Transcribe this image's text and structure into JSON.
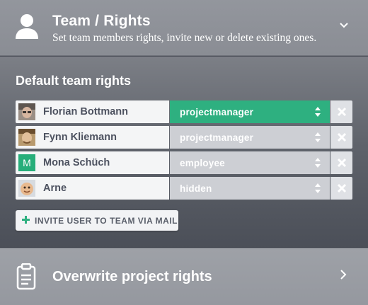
{
  "header": {
    "title": "Team / Rights",
    "subtitle": "Set team members rights, invite new or delete existing ones.",
    "icon": "user-icon",
    "toggle_icon": "chevron-down-icon"
  },
  "default_rights": {
    "title": "Default team rights",
    "members": [
      {
        "name": "Florian Bottmann",
        "role": "projectmanager",
        "active": true,
        "avatar": "photo"
      },
      {
        "name": "Fynn Kliemann",
        "role": "projectmanager",
        "active": false,
        "avatar": "photo"
      },
      {
        "name": "Mona Schüch",
        "role": "employee",
        "active": false,
        "avatar_letter": "M"
      },
      {
        "name": "Arne",
        "role": "hidden",
        "active": false,
        "avatar": "photo"
      }
    ]
  },
  "invite": {
    "label": "INVITE USER TO TEAM VIA MAIL",
    "icon": "plus-icon"
  },
  "footer": {
    "label": "Overwrite project rights",
    "icon": "clipboard-icon",
    "arrow_icon": "chevron-right-icon"
  },
  "colors": {
    "accent": "#2eb080",
    "select_inactive": "#cdcfd4",
    "text_dark": "#4d5260"
  }
}
